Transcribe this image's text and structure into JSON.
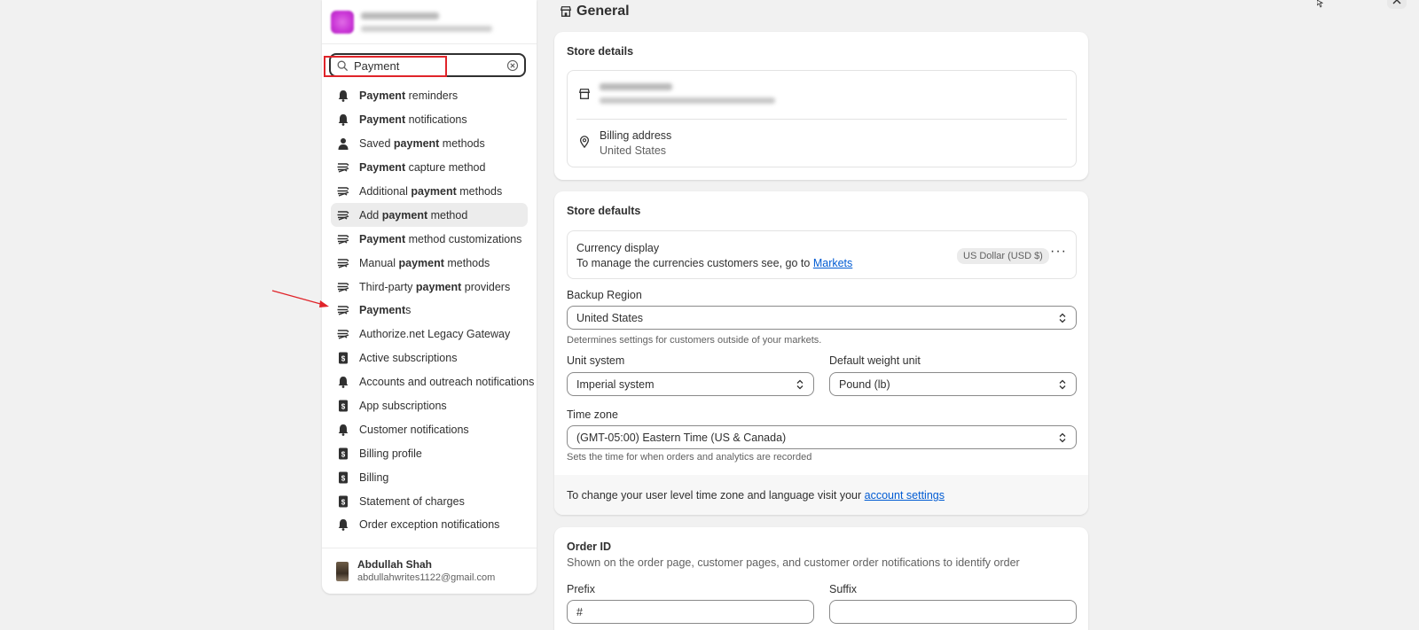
{
  "sidebar": {
    "search": {
      "value": "Payment",
      "placeholder": "Search"
    },
    "results": [
      {
        "bold": "Payment",
        "rest": " reminders",
        "prefix": "",
        "icon": "bell-icon"
      },
      {
        "bold": "Payment",
        "rest": " notifications",
        "prefix": "",
        "icon": "bell-icon"
      },
      {
        "prefix": "Saved ",
        "bold": "payment",
        "rest": " methods",
        "icon": "person-icon"
      },
      {
        "bold": "Payment",
        "rest": " capture method",
        "prefix": "",
        "icon": "payment-icon"
      },
      {
        "prefix": "Additional ",
        "bold": "payment",
        "rest": " methods",
        "icon": "payment-icon"
      },
      {
        "prefix": "Add ",
        "bold": "payment",
        "rest": " method",
        "icon": "payment-icon"
      },
      {
        "bold": "Payment",
        "rest": " method customizations",
        "prefix": "",
        "icon": "payment-icon"
      },
      {
        "prefix": "Manual ",
        "bold": "payment",
        "rest": " methods",
        "icon": "payment-icon"
      },
      {
        "prefix": "Third-party ",
        "bold": "payment",
        "rest": " providers",
        "icon": "payment-icon"
      },
      {
        "bold": "Payment",
        "rest": "s",
        "prefix": "",
        "icon": "payment-icon"
      },
      {
        "prefix": "Authorize.net Legacy Gateway",
        "bold": "",
        "rest": "",
        "icon": "payment-icon"
      },
      {
        "prefix": "Active subscriptions",
        "bold": "",
        "rest": "",
        "icon": "receipt-icon"
      },
      {
        "prefix": "Accounts and outreach notifications",
        "bold": "",
        "rest": "",
        "icon": "bell-icon"
      },
      {
        "prefix": "App subscriptions",
        "bold": "",
        "rest": "",
        "icon": "receipt-icon"
      },
      {
        "prefix": "Customer notifications",
        "bold": "",
        "rest": "",
        "icon": "bell-icon"
      },
      {
        "prefix": "Billing profile",
        "bold": "",
        "rest": "",
        "icon": "receipt-icon"
      },
      {
        "prefix": "Billing",
        "bold": "",
        "rest": "",
        "icon": "receipt-icon"
      },
      {
        "prefix": "Statement of charges",
        "bold": "",
        "rest": "",
        "icon": "receipt-icon"
      },
      {
        "prefix": "Order exception notifications",
        "bold": "",
        "rest": "",
        "icon": "bell-icon"
      }
    ],
    "user": {
      "name": "Abdullah Shah",
      "email": "abdullahwrites1122@gmail.com"
    }
  },
  "main": {
    "title": "General",
    "store_details": {
      "title": "Store details",
      "billing_label": "Billing address",
      "billing_value": "United States"
    },
    "store_defaults": {
      "title": "Store defaults",
      "currency_label": "Currency display",
      "currency_help": "To manage the currencies customers see, go to",
      "currency_link": "Markets",
      "currency_badge": "US Dollar (USD $)",
      "backup_region_label": "Backup Region",
      "backup_region_value": "United States",
      "backup_region_help": "Determines settings for customers outside of your markets.",
      "unit_system_label": "Unit system",
      "unit_system_value": "Imperial system",
      "weight_unit_label": "Default weight unit",
      "weight_unit_value": "Pound (lb)",
      "timezone_label": "Time zone",
      "timezone_value": "(GMT-05:00) Eastern Time (US & Canada)",
      "timezone_help": "Sets the time for when orders and analytics are recorded",
      "footer_text": "To change your user level time zone and language visit your",
      "footer_link": "account settings"
    },
    "order_id": {
      "title": "Order ID",
      "desc": "Shown on the order page, customer pages, and customer order notifications to identify order",
      "prefix_label": "Prefix",
      "prefix_value": "#",
      "suffix_label": "Suffix",
      "suffix_value": ""
    }
  },
  "colors": {
    "highlight": "#e0242a",
    "link": "#005bd3",
    "background": "#f1f1f1"
  }
}
